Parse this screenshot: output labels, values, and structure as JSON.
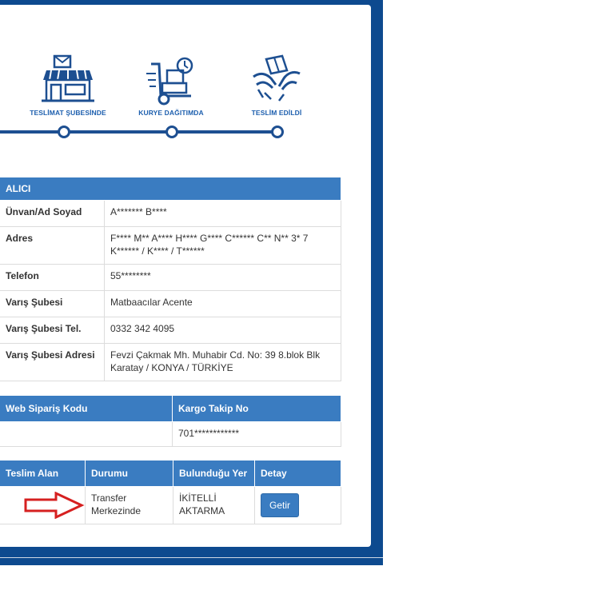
{
  "steps": [
    {
      "label": "TESLİMAT ŞUBESİNDE",
      "icon": "branch-store-icon"
    },
    {
      "label": "KURYE DAĞITIMDA",
      "icon": "courier-trolley-icon"
    },
    {
      "label": "TESLİM EDİLDİ",
      "icon": "delivered-hands-icon"
    }
  ],
  "recipient": {
    "header": "ALICI",
    "rows": [
      {
        "label": "Ünvan/Ad Soyad",
        "value": "A******* B****"
      },
      {
        "label": "Adres",
        "value": "F**** M** A**** H**** G**** C****** C** N** 3* 7 K****** / K**** / T******"
      },
      {
        "label": "Telefon",
        "value": "55********"
      },
      {
        "label": "Varış Şubesi",
        "value": "Matbaacılar Acente"
      },
      {
        "label": "Varış Şubesi Tel.",
        "value": "0332 342 4095"
      },
      {
        "label": "Varış Şubesi Adresi",
        "value": "Fevzi Çakmak Mh. Muhabir Cd. No: 39 8.blok Blk Karatay / KONYA / TÜRKİYE"
      }
    ]
  },
  "order": {
    "headers": [
      "Web Sipariş Kodu",
      "Kargo Takip No"
    ],
    "values": [
      "",
      "701************"
    ]
  },
  "movement": {
    "headers": [
      "Teslim Alan",
      "Durumu",
      "Bulunduğu Yer",
      "Detay"
    ],
    "row": {
      "teslim_alan": "",
      "durumu": "Transfer Merkezinde",
      "bulundugu_yer": "İKİTELLİ AKTARMA",
      "detay_button": "Getir"
    }
  },
  "colors": {
    "brand_blue": "#0d4a8f",
    "header_blue": "#3a7cc1",
    "annotation_arrow": "#d62020"
  }
}
